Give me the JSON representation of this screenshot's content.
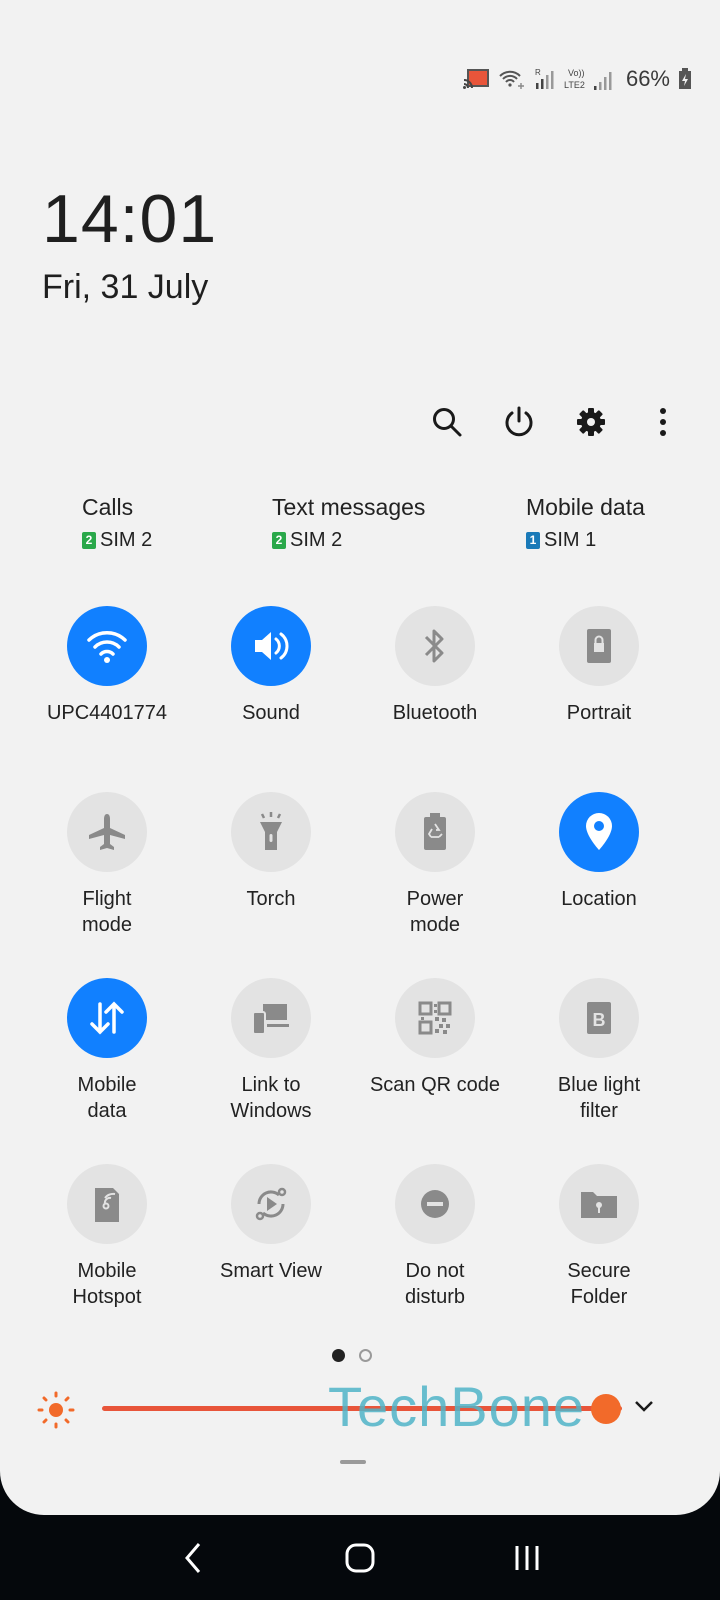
{
  "status_bar": {
    "icons": [
      "screen-cast-icon",
      "wifi-calling-icon",
      "roaming-signal-icon",
      "volte-lte2-signal-icon",
      "battery-charging-icon"
    ],
    "battery_percent": "66%"
  },
  "clock": {
    "time": "14:01",
    "date": "Fri, 31 July"
  },
  "toolbar": {
    "buttons": [
      "search-icon",
      "power-icon",
      "settings-gear-icon",
      "more-options-icon"
    ]
  },
  "sim_preferences": [
    {
      "title": "Calls",
      "sim_number": "2",
      "sim_label": "SIM 2",
      "badge_color": "#2aa84a"
    },
    {
      "title": "Text messages",
      "sim_number": "2",
      "sim_label": "SIM 2",
      "badge_color": "#2aa84a"
    },
    {
      "title": "Mobile data",
      "sim_number": "1",
      "sim_label": "SIM 1",
      "badge_color": "#1a7ab8"
    }
  ],
  "quick_settings": [
    {
      "label": "UPC4401774",
      "icon": "wifi-icon",
      "active": true
    },
    {
      "label": "Sound",
      "icon": "sound-icon",
      "active": true
    },
    {
      "label": "Bluetooth",
      "icon": "bluetooth-icon",
      "active": false
    },
    {
      "label": "Portrait",
      "icon": "portrait-lock-icon",
      "active": false
    },
    {
      "label": "Flight\nmode",
      "icon": "airplane-icon",
      "active": false
    },
    {
      "label": "Torch",
      "icon": "torch-icon",
      "active": false
    },
    {
      "label": "Power\nmode",
      "icon": "power-mode-icon",
      "active": false
    },
    {
      "label": "Location",
      "icon": "location-icon",
      "active": true
    },
    {
      "label": "Mobile\ndata",
      "icon": "mobile-data-icon",
      "active": true
    },
    {
      "label": "Link to\nWindows",
      "icon": "link-to-windows-icon",
      "active": false
    },
    {
      "label": "Scan QR code",
      "icon": "qr-code-icon",
      "active": false
    },
    {
      "label": "Blue light\nfilter",
      "icon": "blue-light-filter-icon",
      "active": false
    },
    {
      "label": "Mobile\nHotspot",
      "icon": "hotspot-icon",
      "active": false
    },
    {
      "label": "Smart View",
      "icon": "smart-view-icon",
      "active": false
    },
    {
      "label": "Do not\ndisturb",
      "icon": "do-not-disturb-icon",
      "active": false
    },
    {
      "label": "Secure\nFolder",
      "icon": "secure-folder-icon",
      "active": false
    }
  ],
  "pager": {
    "pages": 2,
    "current": 1
  },
  "brightness": {
    "level_percent": 97,
    "watermark": "TechBone"
  },
  "colors": {
    "accent": "#1180ff",
    "inactive_tile": "#e3e3e3",
    "brightness": "#e8553a"
  },
  "navigation": [
    "back-icon",
    "home-icon",
    "recents-icon"
  ]
}
